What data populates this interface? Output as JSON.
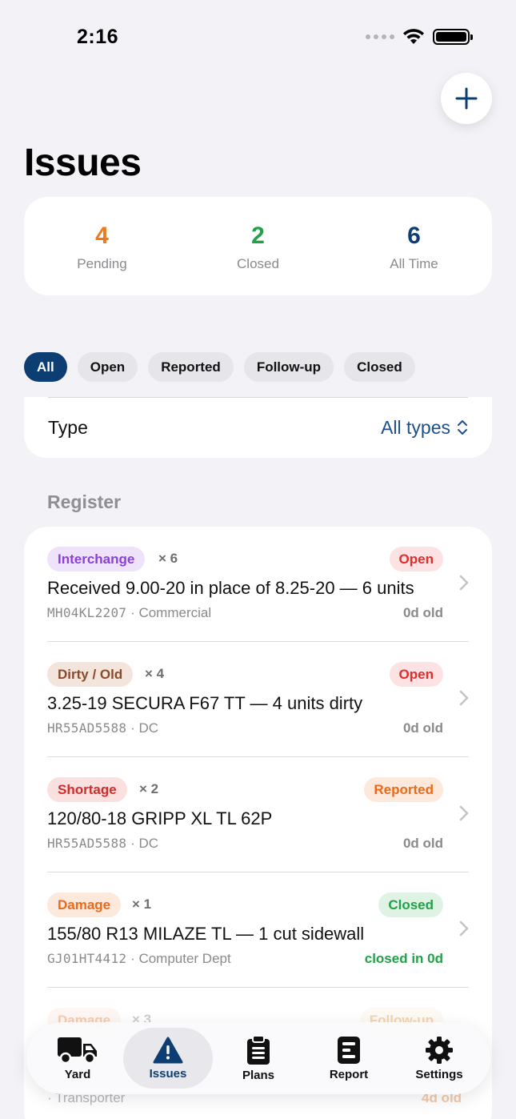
{
  "status_bar": {
    "time": "2:16"
  },
  "header": {
    "title": "Issues"
  },
  "stats": [
    {
      "value": "4",
      "label": "Pending",
      "color": "#ee7a1e"
    },
    {
      "value": "2",
      "label": "Closed",
      "color": "#23a04a"
    },
    {
      "value": "6",
      "label": "All Time",
      "color": "#0d3e73"
    }
  ],
  "filters": [
    "All",
    "Open",
    "Reported",
    "Follow-up",
    "Closed"
  ],
  "type_filter": {
    "label": "Type",
    "value": "All types"
  },
  "section": {
    "label": "Register"
  },
  "issues": [
    {
      "tag": "Interchange",
      "qty": "× 6",
      "status": "Open",
      "title": "Received 9.00-20 in place of 8.25-20 — 6 units",
      "plate": "MH04KL2207",
      "dept": "· Commercial",
      "age": "0d old"
    },
    {
      "tag": "Dirty / Old",
      "qty": "× 4",
      "status": "Open",
      "title": "3.25-19 SECURA F67 TT — 4 units dirty",
      "plate": "HR55AD5588",
      "dept": "· DC",
      "age": "0d old"
    },
    {
      "tag": "Shortage",
      "qty": "× 2",
      "status": "Reported",
      "title": "120/80-18 GRIPP XL TL 62P",
      "plate": "HR55AD5588",
      "dept": "· DC",
      "age": "0d old"
    },
    {
      "tag": "Damage",
      "qty": "× 1",
      "status": "Closed",
      "title": "155/80 R13 MILAZE TL — 1 cut sidewall",
      "plate": "GJ01HT4412",
      "dept": "· Computer Dept",
      "age": "closed in 0d"
    },
    {
      "tag": "Damage",
      "qty": "× 3",
      "status": "Follow-up",
      "title": "",
      "plate": "",
      "dept": "· Transporter",
      "age": "4d old"
    }
  ],
  "tabs": [
    {
      "label": "Yard",
      "icon": "truck-icon"
    },
    {
      "label": "Issues",
      "icon": "warning-icon"
    },
    {
      "label": "Plans",
      "icon": "clipboard-icon"
    },
    {
      "label": "Report",
      "icon": "report-icon"
    },
    {
      "label": "Settings",
      "icon": "gear-icon"
    }
  ]
}
